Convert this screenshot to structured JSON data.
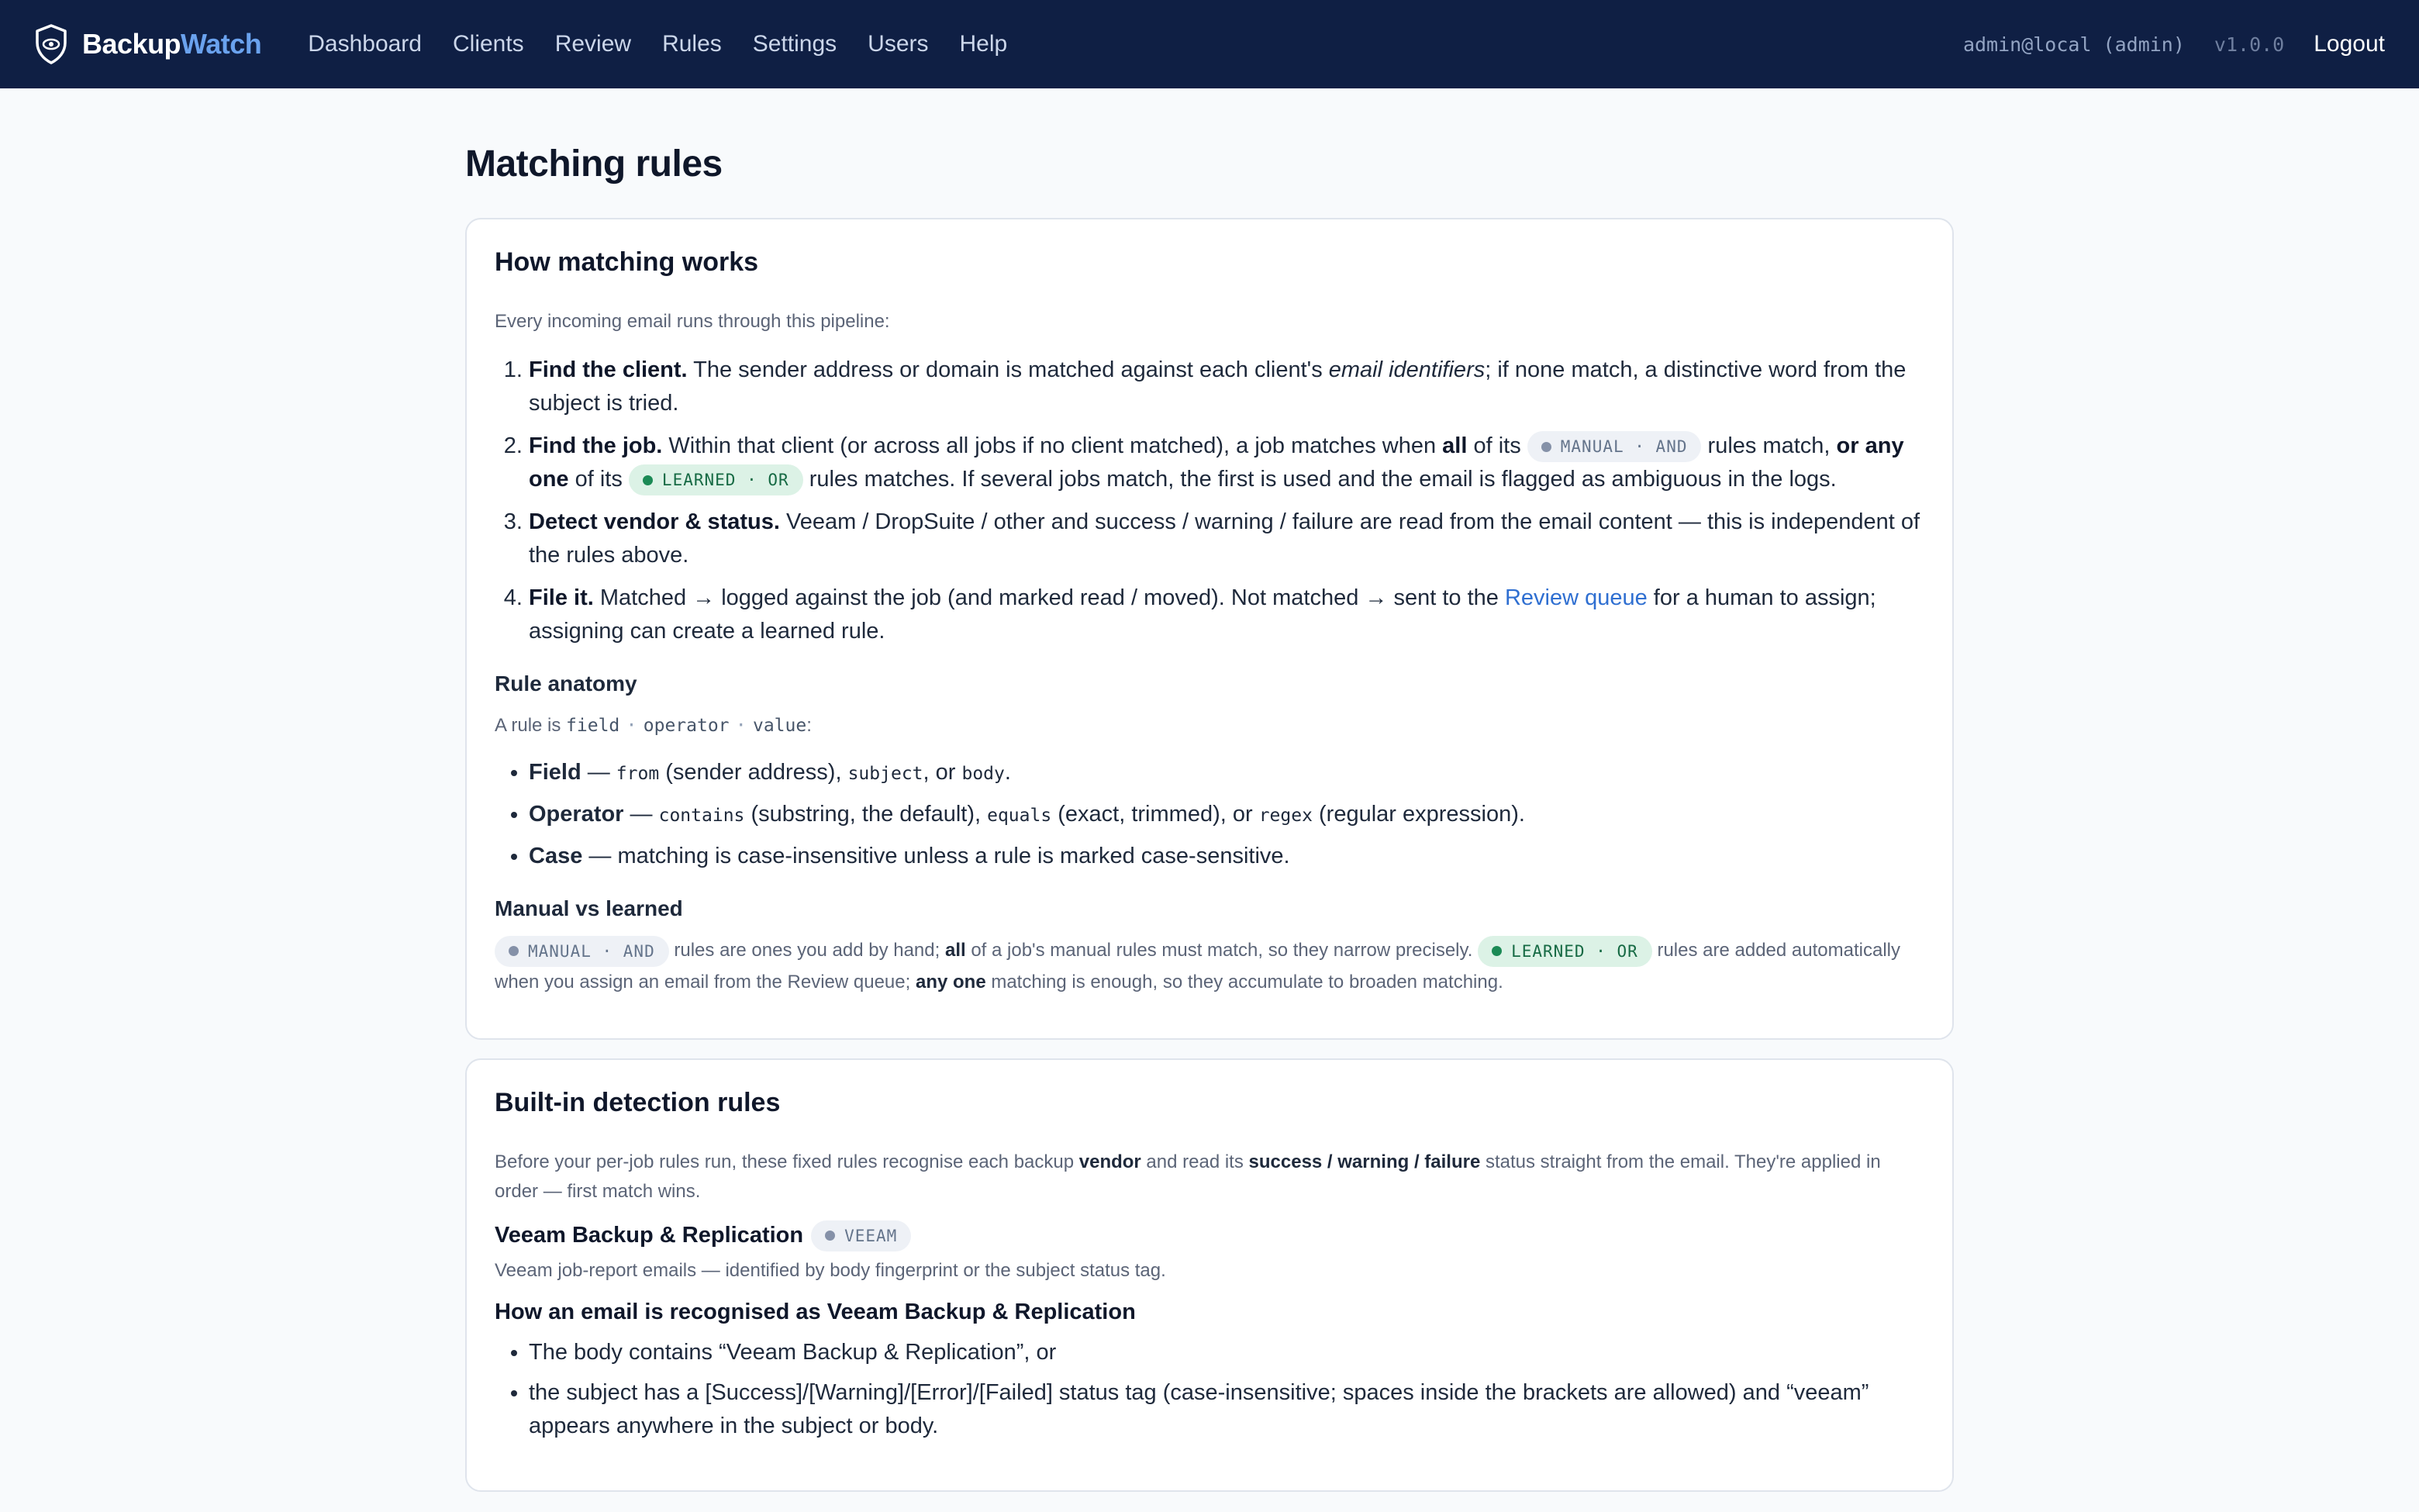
{
  "brand": {
    "name_main": "Backup",
    "name_accent": "Watch",
    "icon": "shield-eye-icon"
  },
  "nav": {
    "items": [
      "Dashboard",
      "Clients",
      "Review",
      "Rules",
      "Settings",
      "Users",
      "Help"
    ],
    "user": "admin@local (admin)",
    "version": "v1.0.0",
    "logout": "Logout"
  },
  "page": {
    "title": "Matching rules"
  },
  "how": {
    "title": "How matching works",
    "intro": "Every incoming email runs through this pipeline:",
    "steps": {
      "s1": {
        "lead": "Find the client.",
        "t1": " The sender address or domain is matched against each client's ",
        "em": "email identifiers",
        "t2": "; if none match, a distinctive word from the subject is tried."
      },
      "s2": {
        "lead": "Find the job.",
        "t1": " Within that client (or across all jobs if no client matched), a job matches when ",
        "b1": "all",
        "t2": " of its ",
        "t3": " rules match, ",
        "b2": "or any one",
        "t4": " of its ",
        "t5": " rules matches. If several jobs match, the first is used and the email is flagged as ambiguous in the logs."
      },
      "s3": {
        "lead": "Detect vendor & status.",
        "t1": " Veeam / DropSuite / other and success / warning / failure are read from the email content — this is independent of the rules above."
      },
      "s4": {
        "lead": "File it.",
        "t1": " Matched → logged against the job (and marked read / moved). Not matched → sent to the ",
        "link": "Review queue",
        "t2": " for a human to assign; assigning can create a learned rule."
      }
    },
    "anatomy": {
      "title": "Rule anatomy",
      "intro_pre": "A rule is ",
      "intro_field": "field",
      "intro_sep": "·",
      "intro_operator": "operator",
      "intro_value": "value",
      "intro_post": ":",
      "field": {
        "lead": "Field",
        "t1": " — ",
        "c1": "from",
        "t2": " (sender address), ",
        "c2": "subject",
        "t3": ", or ",
        "c3": "body",
        "t4": "."
      },
      "operator": {
        "lead": "Operator",
        "t1": " — ",
        "c1": "contains",
        "t2": " (substring, the default), ",
        "c2": "equals",
        "t3": " (exact, trimmed), or ",
        "c3": "regex",
        "t4": " (regular expression)."
      },
      "case": {
        "lead": "Case",
        "t1": " — matching is case-insensitive unless a rule is marked case-sensitive."
      }
    },
    "mvl": {
      "title": "Manual vs learned",
      "t1": " rules are ones you add by hand; ",
      "b1": "all",
      "t2": " of a job's manual rules must match, so they narrow precisely. ",
      "t3": " rules are added automatically when you assign an email from the Review queue; ",
      "b2": "any one",
      "t4": " matching is enough, so they accumulate to broaden matching."
    }
  },
  "badges": {
    "manual": "MANUAL · AND",
    "learned": "LEARNED · OR",
    "veeam": "VEEAM"
  },
  "builtin": {
    "title": "Built-in detection rules",
    "intro_t1": "Before your per-job rules run, these fixed rules recognise each backup ",
    "intro_b1": "vendor",
    "intro_t2": " and read its ",
    "intro_b2": "success / warning / failure",
    "intro_t3": " status straight from the email. They're applied in order — first match wins.",
    "veeam": {
      "name": "Veeam Backup & Replication",
      "desc": "Veeam job-report emails — identified by body fingerprint or the subject status tag.",
      "how_title": "How an email is recognised as Veeam Backup & Replication",
      "r1": "The body contains “Veeam Backup & Replication”, or",
      "r2": "the subject has a [Success]/[Warning]/[Error]/[Failed] status tag (case-insensitive; spaces inside the brackets are allowed) and “veeam” appears anywhere in the subject or body."
    }
  },
  "colors": {
    "nav_bg": "#0f1f44",
    "accent": "#6aa2ee",
    "link": "#2f6fd1",
    "learned_bg": "#dcf2e6",
    "learned_fg": "#166a44"
  }
}
